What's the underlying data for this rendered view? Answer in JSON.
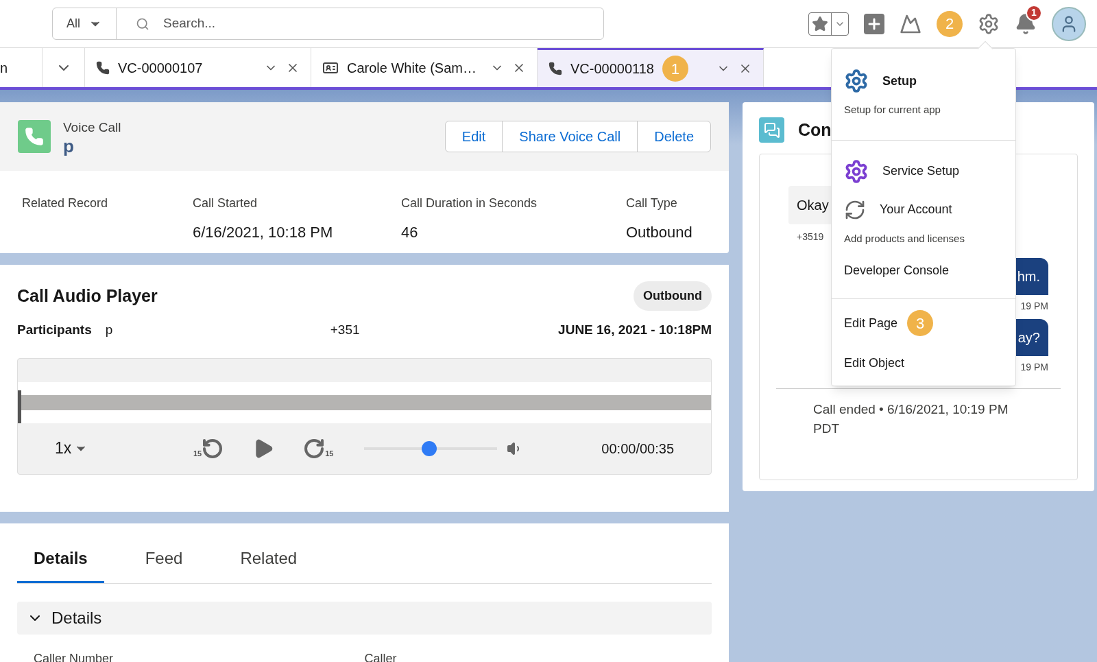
{
  "global_header": {
    "search": {
      "scope": "All",
      "placeholder": "Search..."
    },
    "help_callout": "2",
    "notification_count": "1"
  },
  "tabs": [
    {
      "label": "n",
      "kind": "home",
      "selected": false
    },
    {
      "label": "VC-00000107",
      "kind": "call",
      "selected": false
    },
    {
      "label": "Carole White (Sam…",
      "kind": "contact",
      "selected": false
    },
    {
      "label": "VC-00000118",
      "kind": "call",
      "selected": true,
      "callout": "1"
    }
  ],
  "record": {
    "object": "Voice Call",
    "name": "p",
    "actions": [
      "Edit",
      "Share Voice Call",
      "Delete"
    ],
    "fields": [
      {
        "label": "Related Record"
      },
      {
        "label": "Call Started",
        "value": "6/16/2021, 10:18 PM"
      },
      {
        "label": "Call Duration in Seconds",
        "value": "46"
      },
      {
        "label": "Call Type",
        "value": "Outbound"
      }
    ]
  },
  "audio_player": {
    "title": "Call Audio Player",
    "call_type": "Outbound",
    "participants_label": "Participants",
    "participant_name": "p",
    "participant_number": "+351",
    "datetime": "JUNE 16, 2021 - 10:18PM",
    "speed": "1x",
    "skip_back": "15",
    "skip_forward": "15",
    "position": {
      "level": 0
    },
    "volume": {
      "level": 0.49
    },
    "time": "00:00/00:35"
  },
  "detail_tabs": [
    {
      "label": "Details",
      "selected": true
    },
    {
      "label": "Feed",
      "selected": false
    },
    {
      "label": "Related",
      "selected": false
    }
  ],
  "details_section": {
    "title": "Details",
    "expanded": true,
    "fields": [
      {
        "label": "Caller Number"
      },
      {
        "label": "Caller"
      }
    ]
  },
  "conversation": {
    "title": "Con",
    "messages": [
      {
        "kind": "incoming",
        "text": "Okay",
        "meta": "+3519"
      },
      {
        "kind": "outgoing",
        "text": "hm.",
        "meta": "19 PM"
      },
      {
        "kind": "outgoing",
        "text": "ay?",
        "meta": "19 PM"
      }
    ],
    "footer": "Call ended • 6/16/2021, 10:19 PM PDT"
  },
  "setup_menu": {
    "sections": [
      [
        {
          "label": "Setup",
          "kind": "setup",
          "description": "Setup for current app"
        }
      ],
      [
        {
          "label": "Service Setup",
          "kind": "service"
        },
        {
          "label": "Your Account",
          "kind": "account",
          "description": "Add products and licenses"
        },
        {
          "label": "Developer Console",
          "kind": "link"
        }
      ],
      [
        {
          "label": "Edit Page",
          "kind": "link",
          "callout": "3"
        },
        {
          "label": "Edit Object",
          "kind": "link"
        }
      ]
    ]
  }
}
